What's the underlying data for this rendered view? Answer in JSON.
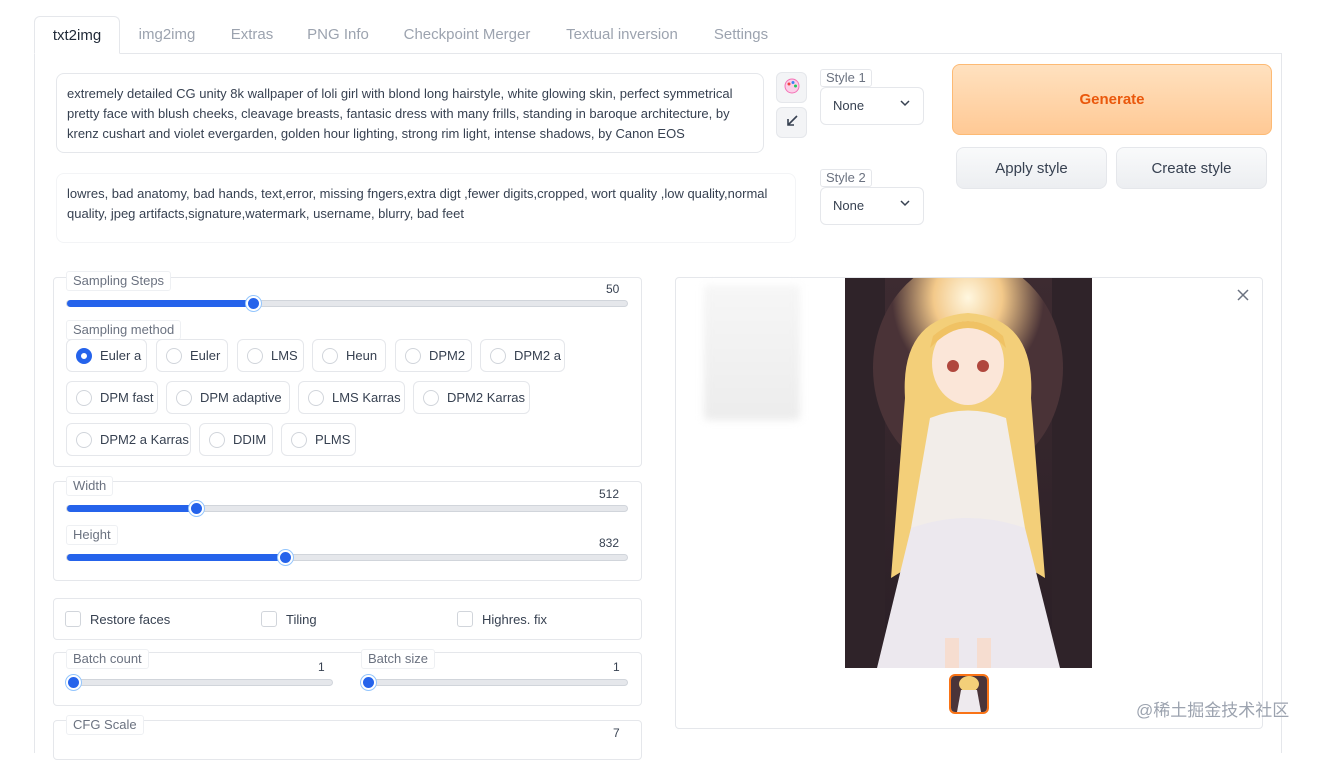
{
  "tabs": [
    "txt2img",
    "img2img",
    "Extras",
    "PNG Info",
    "Checkpoint Merger",
    "Textual inversion",
    "Settings"
  ],
  "prompt": "extremely detailed CG unity 8k wallpaper of loli girl with blond long hairstyle, white glowing skin, perfect symmetrical pretty face with blush cheeks, cleavage breasts, fantasic dress with many frills, standing in baroque architecture, by krenz cushart and violet evergarden, golden hour lighting, strong rim light, intense shadows, by Canon EOS",
  "negative_prompt": "lowres, bad anatomy, bad hands, text,error, missing fngers,extra digt ,fewer digits,cropped, wort quality ,low quality,normal quality, jpeg artifacts,signature,watermark, username, blurry, bad feet",
  "icons": {
    "paint": "palette-icon",
    "arrow": "arrow-down-left-icon",
    "chevron": "chevron-down-icon",
    "close": "close-icon"
  },
  "style1": {
    "label": "Style 1",
    "value": "None"
  },
  "style2": {
    "label": "Style 2",
    "value": "None"
  },
  "buttons": {
    "generate": "Generate",
    "apply_style": "Apply style",
    "create_style": "Create style"
  },
  "sampling_steps": {
    "label": "Sampling Steps",
    "value": "50",
    "fraction": 0.33
  },
  "sampling_method": {
    "label": "Sampling method",
    "options": [
      "Euler a",
      "Euler",
      "LMS",
      "Heun",
      "DPM2",
      "DPM2 a",
      "DPM fast",
      "DPM adaptive",
      "LMS Karras",
      "DPM2 Karras",
      "DPM2 a Karras",
      "DDIM",
      "PLMS"
    ],
    "selected": "Euler a"
  },
  "width": {
    "label": "Width",
    "value": "512",
    "fraction": 0.23
  },
  "height": {
    "label": "Height",
    "value": "832",
    "fraction": 0.39
  },
  "checkboxes": {
    "restore_faces": "Restore faces",
    "tiling": "Tiling",
    "highres_fix": "Highres. fix"
  },
  "batch_count": {
    "label": "Batch count",
    "value": "1",
    "fraction": 0
  },
  "batch_size": {
    "label": "Batch size",
    "value": "1",
    "fraction": 0
  },
  "cfg_scale": {
    "label": "CFG Scale",
    "value": "7"
  },
  "watermark": "@稀土掘金技术社区",
  "colors": {
    "accent": "#2563eb",
    "generate": "#ea580c"
  }
}
